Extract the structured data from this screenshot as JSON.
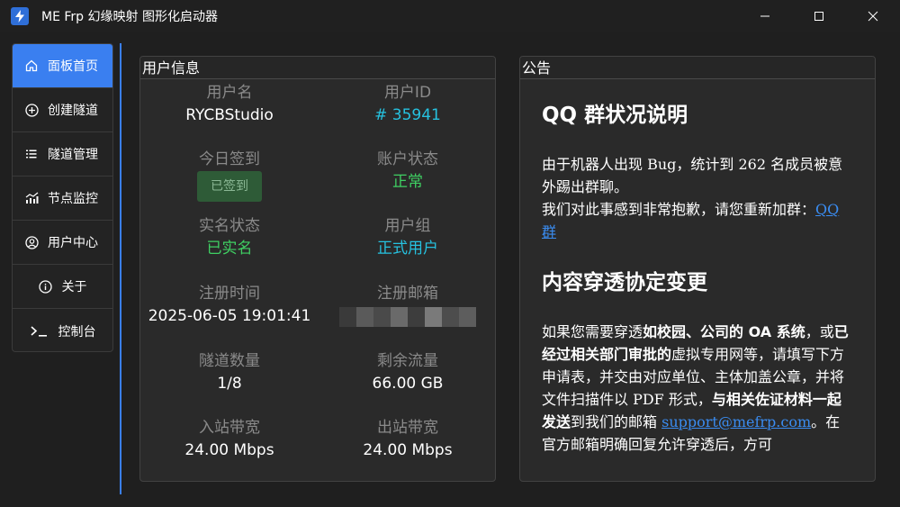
{
  "window": {
    "title": "ME Frp 幻缘映射 图形化启动器",
    "colors": {
      "accent": "#3a7ff0",
      "background": "#1f1f1f",
      "panel": "#2a2a2a"
    }
  },
  "sidebar": {
    "items": [
      {
        "label": "面板首页",
        "icon": "home-icon"
      },
      {
        "label": "创建隧道",
        "icon": "plus-circle-icon"
      },
      {
        "label": "隧道管理",
        "icon": "list-icon"
      },
      {
        "label": "节点监控",
        "icon": "chart-icon"
      },
      {
        "label": "用户中心",
        "icon": "user-circle-icon"
      },
      {
        "label": "关于",
        "icon": "info-icon"
      },
      {
        "label": "控制台",
        "icon": "terminal-icon"
      }
    ]
  },
  "user_info": {
    "title": "用户信息",
    "username_label": "用户名",
    "username": "RYCBStudio",
    "userid_label": "用户ID",
    "userid": "# 35941",
    "checkin_label": "今日签到",
    "checkin_button": "已签到",
    "account_status_label": "账户状态",
    "account_status": "正常",
    "realname_label": "实名状态",
    "realname_status": "已实名",
    "group_label": "用户组",
    "group": "正式用户",
    "register_time_label": "注册时间",
    "register_time": "2025-06-05 19:01:41",
    "register_email_label": "注册邮箱",
    "tunnel_count_label": "隧道数量",
    "tunnel_count": "1/8",
    "traffic_label": "剩余流量",
    "traffic": "66.00 GB",
    "inbound_label": "入站带宽",
    "inbound": "24.00 Mbps",
    "outbound_label": "出站带宽",
    "outbound": "24.00 Mbps"
  },
  "notice": {
    "title": "公告",
    "section1_heading": "QQ 群状况说明",
    "section1_p1": "由于机器人出现 Bug，统计到 262 名成员被意外踢出群聊。",
    "section1_p2_prefix": "我们对此事感到非常抱歉，请您重新加群：",
    "section1_link": "QQ 群",
    "section2_heading": "内容穿透协定变更",
    "section2_t1": "如果您需要穿透",
    "section2_b1": "如校园、公司的 OA 系统",
    "section2_t2": "，或",
    "section2_b2": "已经过相关部门审批的",
    "section2_t3": "虚拟专用网等，请填写下方申请表，并交由对应单位、主体加盖公章，并将文件扫描件以 PDF 形式，",
    "section2_b3": "与相关佐证材料一起发送",
    "section2_t4": "到我们的邮箱 ",
    "section2_email": "support@mefrp.com",
    "section2_t5": "。在官方邮箱明确回复允许穿透后，方可"
  }
}
